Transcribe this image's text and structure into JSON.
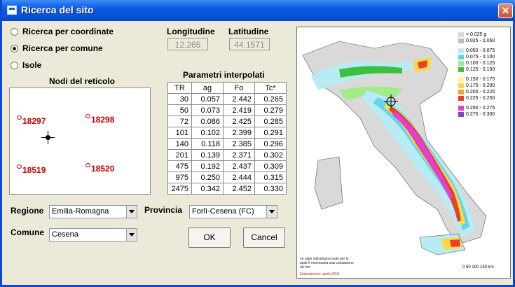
{
  "window": {
    "title": "Ricerca del sito"
  },
  "search_mode": {
    "options": [
      "Ricerca per coordinate",
      "Ricerca per comune",
      "Isole"
    ],
    "selected": "Ricerca per comune"
  },
  "coords": {
    "longitude_label": "Longitudine",
    "longitude_value": "12.265",
    "latitude_label": "Latitudine",
    "latitude_value": "44.1571"
  },
  "grid_nodes": {
    "title": "Nodi del reticolo",
    "nodes": [
      "18297",
      "18298",
      "18519",
      "18520"
    ]
  },
  "params": {
    "title": "Parametri interpolati",
    "headers": [
      "TR",
      "ag",
      "Fo",
      "Tc*"
    ],
    "rows": [
      [
        "30",
        "0.057",
        "2.442",
        "0.265"
      ],
      [
        "50",
        "0.073",
        "2.419",
        "0.279"
      ],
      [
        "72",
        "0.086",
        "2.425",
        "0.285"
      ],
      [
        "101",
        "0.102",
        "2.399",
        "0.291"
      ],
      [
        "140",
        "0.118",
        "2.385",
        "0.296"
      ],
      [
        "201",
        "0.139",
        "2.371",
        "0.302"
      ],
      [
        "475",
        "0.192",
        "2.437",
        "0.309"
      ],
      [
        "975",
        "0.250",
        "2.444",
        "0.315"
      ],
      [
        "2475",
        "0.342",
        "2.452",
        "0.330"
      ]
    ]
  },
  "location": {
    "region_label": "Regione",
    "region_value": "Emilia-Romagna",
    "province_label": "Provincia",
    "province_value": "Forlì-Cesena (FC)",
    "comune_label": "Comune",
    "comune_value": "Cesena"
  },
  "buttons": {
    "ok": "OK",
    "cancel": "Cancel"
  },
  "map": {
    "legend": [
      {
        "label": "< 0.025 g",
        "color": "#d9d9d9"
      },
      {
        "label": "0.025 - 0.050",
        "color": "#bdbdbd"
      },
      {
        "label": "0.050 - 0.075",
        "color": "#b8ecf5"
      },
      {
        "label": "0.075 - 0.100",
        "color": "#62d6e8"
      },
      {
        "label": "0.100 - 0.125",
        "color": "#a3ea8a"
      },
      {
        "label": "0.125 - 0.150",
        "color": "#3fbf3f"
      },
      {
        "label": "0.150 - 0.175",
        "color": "#fff59a"
      },
      {
        "label": "0.175 - 0.200",
        "color": "#ffd84a"
      },
      {
        "label": "0.200 - 0.225",
        "color": "#f6a035"
      },
      {
        "label": "0.225 - 0.250",
        "color": "#e8402a"
      },
      {
        "label": "0.250 - 0.275",
        "color": "#e040d8"
      },
      {
        "label": "0.275 - 0.300",
        "color": "#8a3fc0"
      }
    ],
    "note": "Le sigle individuano isole per le quali è necessaria una valutazione ad hoc",
    "credit": "Elaborazione: aprile 2004",
    "scale": "0 50 100 150 km"
  }
}
